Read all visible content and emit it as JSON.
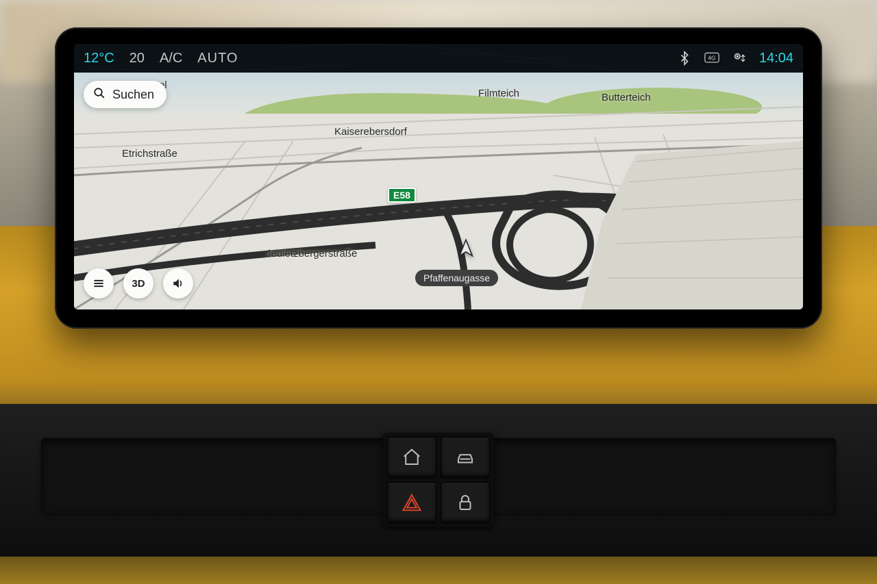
{
  "statusbar": {
    "temperature": "12°C",
    "fan_speed": "20",
    "ac_label": "A/C",
    "mode": "AUTO",
    "time": "14:04",
    "icons": {
      "bluetooth": "bluetooth-icon",
      "network_4g": "4G",
      "gps": "gps-icon"
    }
  },
  "search": {
    "placeholder": "Suchen"
  },
  "map": {
    "labels": {
      "filmteich": "Filmteich",
      "butterteich": "Butterteich",
      "kaiserebersdorf": "Kaiserebersdorf",
      "etrichstrasse": "Etrichstraße",
      "jedletzbergerstrasse": "Jedletzbergerstraße",
      "cut_off_label": "el"
    },
    "route_badge": "E58",
    "current_street": "Pfaffenaugasse"
  },
  "controls": {
    "menu": "≡",
    "view_mode": "3D",
    "voice": "🔊"
  },
  "physical_buttons": {
    "home": "home",
    "vehicle": "vehicle",
    "hazard": "hazard",
    "lock": "lock"
  }
}
